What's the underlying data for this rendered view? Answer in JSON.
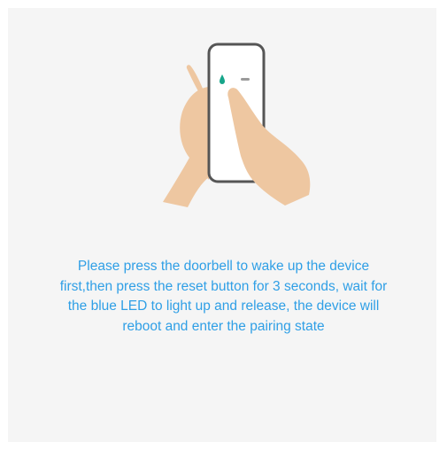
{
  "instructions": {
    "text": "Please press the doorbell to wake up the device first,then press the reset button for 3 seconds, wait for the blue LED to light up and release, the device will reboot and enter the pairing state"
  },
  "colors": {
    "background": "#f5f5f5",
    "text_accent": "#2f9fe6",
    "skin": "#eec7a1",
    "device_body": "#ffffff",
    "device_outline": "#555555",
    "led": "#16a58a"
  },
  "icons": {
    "illustration": "hand-pressing-doorbell-reset-icon"
  }
}
